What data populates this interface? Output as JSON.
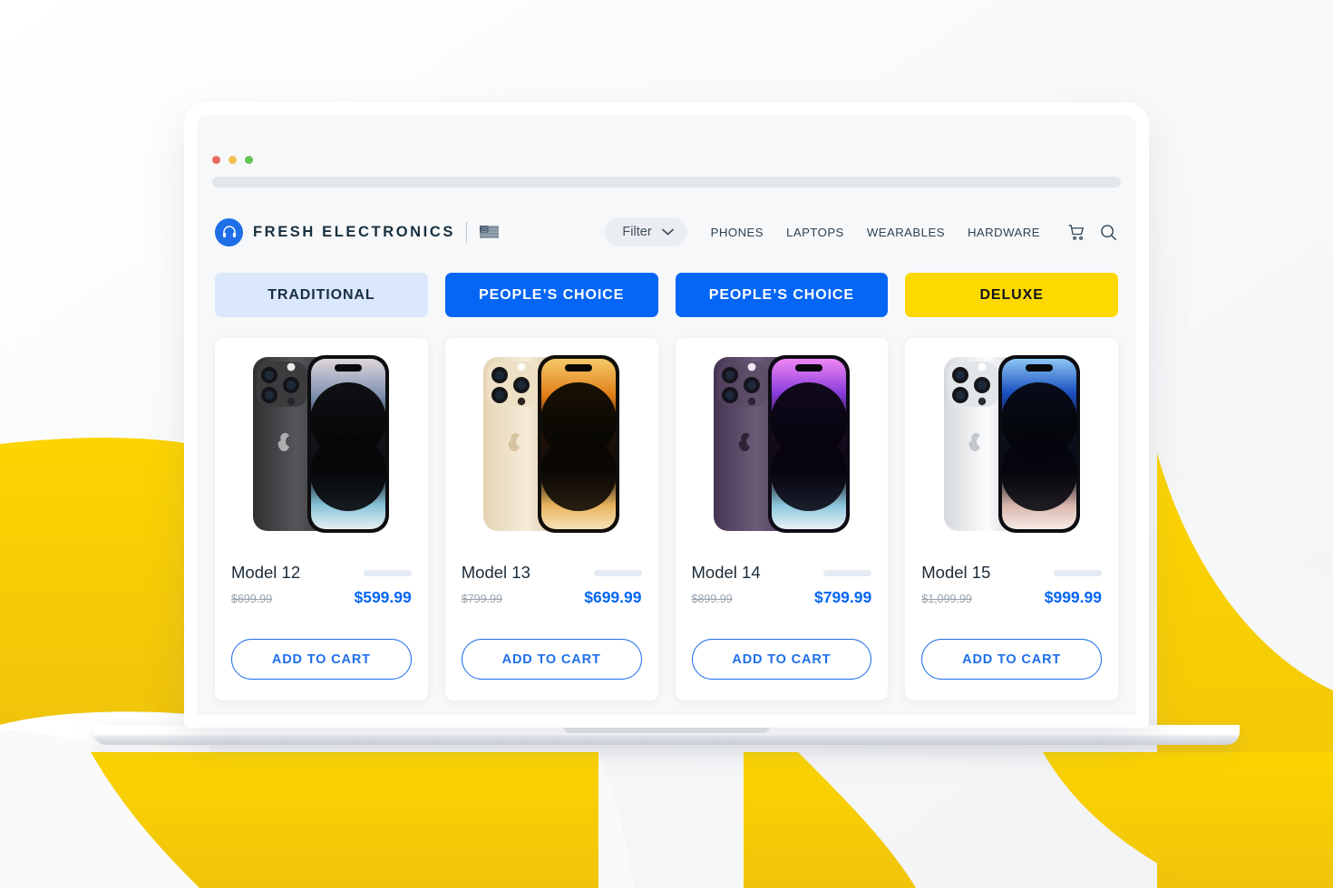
{
  "browser": {
    "window_controls": [
      "close-red",
      "minimize-yellow",
      "maximize-green"
    ],
    "url_bar_value": ""
  },
  "header": {
    "brand_name": "FRESH ELECTRONICS",
    "logo_icon": "headphones-icon",
    "flag_icon": "us-flag-icon",
    "filter": {
      "label": "Filter",
      "chevron_icon": "chevron-down-icon"
    },
    "nav_links": [
      "PHONES",
      "LAPTOPS",
      "WEARABLES",
      "HARDWARE"
    ],
    "cart_icon": "shopping-cart-icon",
    "search_icon": "search-icon"
  },
  "badges": [
    {
      "label": "TRADITIONAL",
      "style": "traditional",
      "color": "#dbe8fb"
    },
    {
      "label": "PEOPLE’S CHOICE",
      "style": "peoples",
      "color": "#0566f5"
    },
    {
      "label": "PEOPLE’S CHOICE",
      "style": "peoples",
      "color": "#0566f5"
    },
    {
      "label": "DELUXE",
      "style": "deluxe",
      "color": "#fdd900"
    }
  ],
  "products": [
    {
      "name": "Model 12",
      "old_price": "$699.99",
      "new_price": "$599.99",
      "cta": "ADD TO CART",
      "image_alt": "smartphone-space-black",
      "body_color": "#4a4a4c",
      "body_color_dark": "#2a2a2c",
      "screen_top": "#d8d2d6",
      "screen_mid": "#6f86a8",
      "screen_bottom": "#cfe3ec"
    },
    {
      "name": "Model 13",
      "old_price": "$799.99",
      "new_price": "$699.99",
      "cta": "ADD TO CART",
      "image_alt": "smartphone-gold",
      "body_color": "#e8d6b4",
      "body_color_dark": "#cdb88f",
      "screen_top": "#f2b24a",
      "screen_mid": "#d9781c",
      "screen_bottom": "#f3d08a"
    },
    {
      "name": "Model 14",
      "old_price": "$899.99",
      "new_price": "$799.99",
      "cta": "ADD TO CART",
      "image_alt": "smartphone-deep-purple",
      "body_color": "#5b4a63",
      "body_color_dark": "#3d3145",
      "screen_top": "#e17cf0",
      "screen_mid": "#7b3ad0",
      "screen_bottom": "#cfe4ee"
    },
    {
      "name": "Model 15",
      "old_price": "$1,099.99",
      "new_price": "$999.99",
      "cta": "ADD TO CART",
      "image_alt": "smartphone-silver",
      "body_color": "#e2e4e6",
      "body_color_dark": "#bfc3c7",
      "screen_top": "#7fbdf0",
      "screen_mid": "#1b56c4",
      "screen_bottom": "#f0d9d0"
    }
  ],
  "theme": {
    "accent_blue": "#0566f5",
    "accent_yellow": "#fdd900",
    "text_dark": "#18303f",
    "background": "#ffffff"
  }
}
